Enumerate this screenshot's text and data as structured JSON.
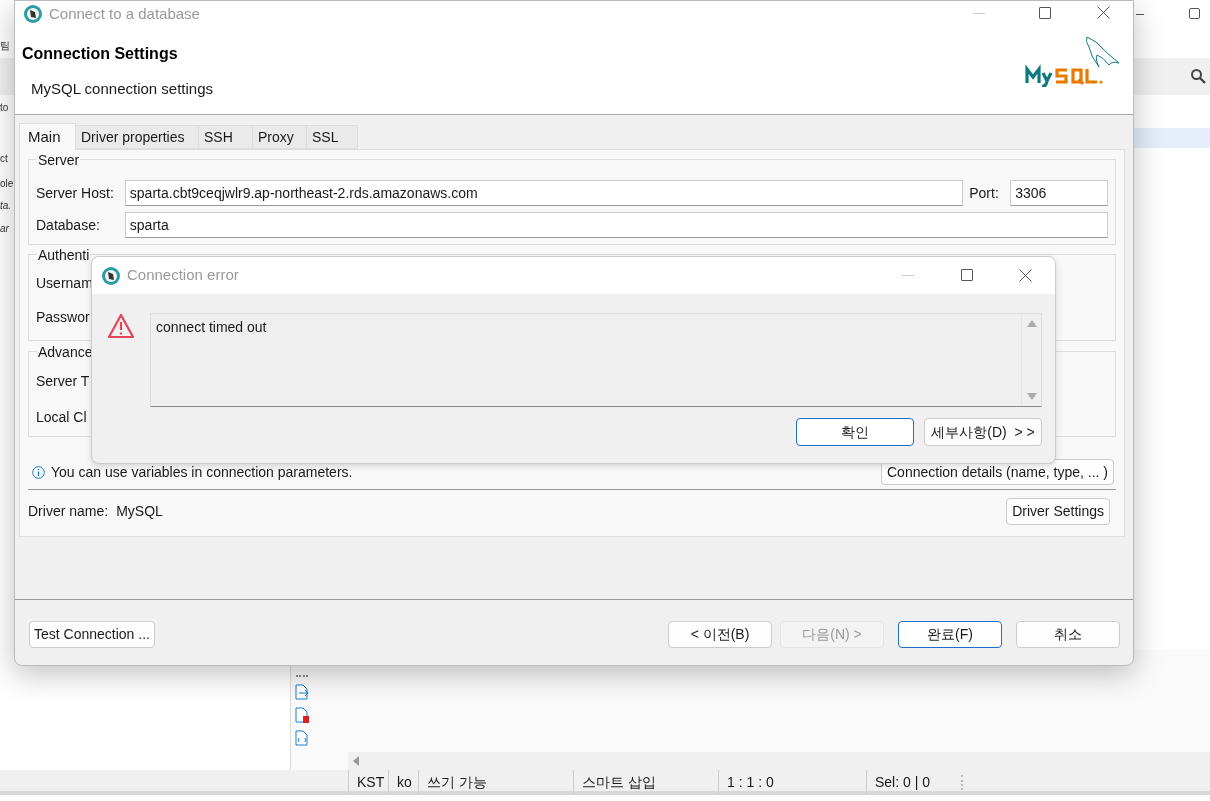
{
  "background_window": {
    "left_fragments": [
      "팀",
      "to",
      "ct",
      "ole",
      "ta.",
      "ar"
    ],
    "status_bar": [
      "KST",
      "ko",
      "쓰기 가능",
      "스마트 삽입",
      "1 : 1 : 0",
      "Sel: 0 | 0"
    ]
  },
  "dialog": {
    "title": "Connect to a database",
    "heading": "Connection Settings",
    "subtitle": "MySQL connection settings",
    "tabs": [
      {
        "label": "Main",
        "selected": true
      },
      {
        "label": "Driver properties",
        "selected": false
      },
      {
        "label": "SSH",
        "selected": false
      },
      {
        "label": "Proxy",
        "selected": false
      },
      {
        "label": "SSL",
        "selected": false
      }
    ],
    "server": {
      "legend": "Server",
      "host_label": "Server Host:",
      "host": "sparta.cbt9ceqjwlr9.ap-northeast-2.rds.amazonaws.com",
      "port_label": "Port:",
      "port": "3306",
      "database_label": "Database:",
      "database": "sparta"
    },
    "authentication": {
      "legend": "Authenti",
      "labels": [
        "Usernam",
        "Passwor"
      ]
    },
    "advanced": {
      "legend": "Advance",
      "labels": [
        "Server T",
        "Local Cl"
      ]
    },
    "info": "You can use variables in connection parameters.",
    "connection_details_button": "Connection details (name, type, ... )",
    "driver_label": "Driver name:",
    "driver_name": "MySQL",
    "driver_settings_button": "Driver Settings",
    "test_button": "Test Connection ...",
    "buttons": [
      {
        "label": "< 이전(B)",
        "disabled": false,
        "primary": false
      },
      {
        "label": "다음(N) >",
        "disabled": true,
        "primary": false
      },
      {
        "label": "완료(F)",
        "disabled": false,
        "primary": true
      },
      {
        "label": "취소",
        "disabled": false,
        "primary": false
      }
    ]
  },
  "error_dialog": {
    "title": "Connection error",
    "message": "connect timed out",
    "buttons": [
      {
        "label": "확인",
        "primary": true
      },
      {
        "label": "세부사항(D)  > >",
        "primary": false
      }
    ]
  }
}
